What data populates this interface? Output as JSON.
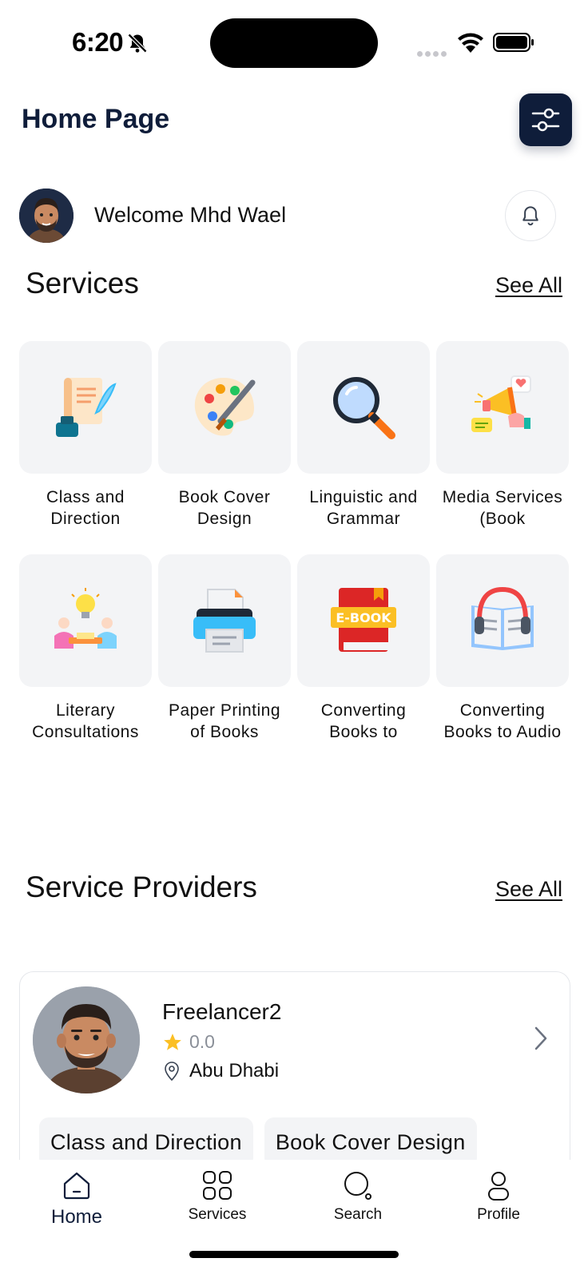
{
  "status_bar": {
    "time": "6:20"
  },
  "header": {
    "title": "Home Page"
  },
  "welcome": {
    "text": "Welcome Mhd Wael"
  },
  "services_section": {
    "title": "Services",
    "see_all": "See All",
    "items": [
      {
        "label": "Class and Direction",
        "icon": "manuscript-icon"
      },
      {
        "label": "Book Cover Design",
        "icon": "palette-icon"
      },
      {
        "label": "Linguistic and Grammar",
        "icon": "magnifier-icon"
      },
      {
        "label": "Media Services (Book",
        "icon": "megaphone-icon"
      },
      {
        "label": "Literary Consultations",
        "icon": "consultation-icon"
      },
      {
        "label": "Paper Printing of Books",
        "icon": "printer-icon"
      },
      {
        "label": "Converting Books to",
        "icon": "ebook-icon"
      },
      {
        "label": "Converting Books to Audio",
        "icon": "audiobook-icon"
      }
    ]
  },
  "providers_section": {
    "title": "Service Providers",
    "see_all": "See All",
    "providers": [
      {
        "name": "Freelancer2",
        "rating": "0.0",
        "location": "Abu Dhabi",
        "services": [
          "Class and Direction",
          "Book Cover Design"
        ]
      }
    ]
  },
  "bottom_nav": {
    "items": [
      {
        "label": "Home",
        "icon": "home-icon",
        "active": true
      },
      {
        "label": "Services",
        "icon": "grid-icon",
        "active": false
      },
      {
        "label": "Search",
        "icon": "search-icon",
        "active": false
      },
      {
        "label": "Profile",
        "icon": "user-icon",
        "active": false
      }
    ]
  },
  "colors": {
    "primary": "#0f1d3a",
    "tile_bg": "#f3f4f6",
    "star": "#fbbf24"
  }
}
